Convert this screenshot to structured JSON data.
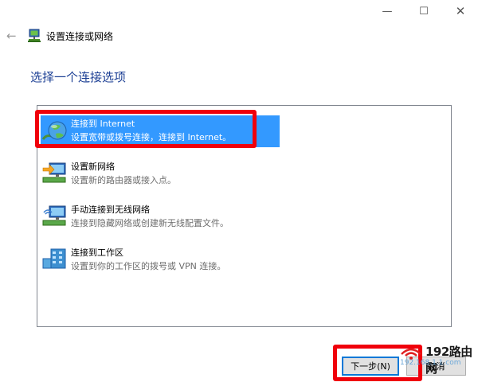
{
  "window": {
    "title": "设置连接或网络",
    "minimize_glyph": "—",
    "maximize_glyph": "☐",
    "close_glyph": "✕",
    "back_glyph": "←"
  },
  "heading": "选择一个连接选项",
  "options": [
    {
      "title": "连接到 Internet",
      "description": "设置宽带或拨号连接，连接到 Internet。",
      "icon": "globe-network-icon",
      "selected": true
    },
    {
      "title": "设置新网络",
      "description": "设置新的路由器或接入点。",
      "icon": "new-network-icon",
      "selected": false
    },
    {
      "title": "手动连接到无线网络",
      "description": "连接到隐藏网络或创建新无线配置文件。",
      "icon": "wireless-network-icon",
      "selected": false
    },
    {
      "title": "连接到工作区",
      "description": "设置到你的工作区的拨号或 VPN 连接。",
      "icon": "workplace-icon",
      "selected": false
    }
  ],
  "buttons": {
    "next": "下一步(N)",
    "cancel": "取消"
  },
  "watermark": {
    "brand": "192路由网",
    "url": "192.168.1.1.com"
  },
  "colors": {
    "heading": "#1c3f94",
    "selection": "#3399ff",
    "highlight_box": "#f0000b",
    "primary_button_border": "#0078d7"
  }
}
